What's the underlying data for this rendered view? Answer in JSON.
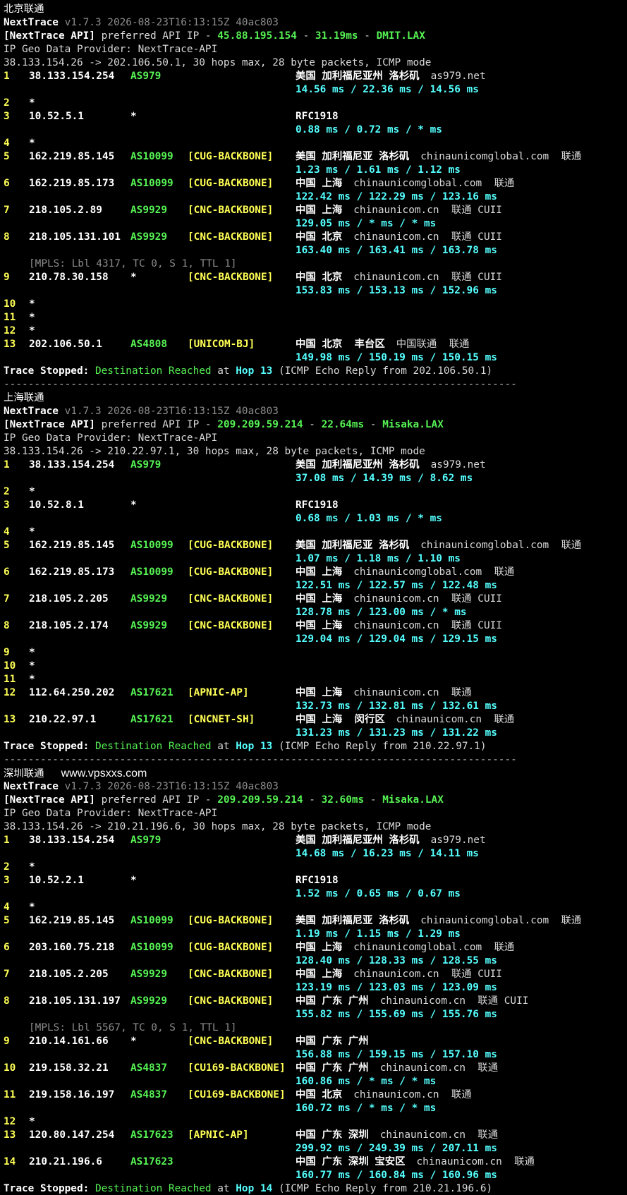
{
  "app": {
    "name": "NextTrace",
    "version": "v1.7.3 2026-08-23T16:13:15Z 40ac803"
  },
  "labels": {
    "api_prefix": "[NextTrace API]",
    "api_mid": "preferred API IP",
    "geo_line": "IP Geo Data Provider: NextTrace-API",
    "trace_stopped": "Trace Stopped:",
    "destination_reached": "Destination Reached",
    "at": "at",
    "hop_word": "Hop",
    "separator": "------------------------------------------------------------------------------------"
  },
  "watermark": "www.vpsxxs.com",
  "traces": [
    {
      "title": "北京联通",
      "api_ip": "45.88.195.154",
      "api_latency": "31.19ms",
      "api_node": "DMIT.LAX",
      "target_line": "38.133.154.26 -> 202.106.50.1, 30 hops max, 28 byte packets, ICMP mode",
      "hops": [
        {
          "n": "1",
          "ip": "38.133.154.254",
          "as": "AS979",
          "tag": "",
          "geo": "美国 加利福尼亚州 洛杉矶",
          "geo_extra": "as979.net",
          "rtt": "14.56 ms / 22.36 ms / 14.56 ms"
        },
        {
          "n": "2",
          "star": true
        },
        {
          "n": "3",
          "ip": "10.52.5.1",
          "as": "*",
          "tag": "",
          "geo": "RFC1918",
          "geo_extra": "",
          "rtt": "0.88 ms / 0.72 ms / * ms"
        },
        {
          "n": "4",
          "star": true
        },
        {
          "n": "5",
          "ip": "162.219.85.145",
          "as": "AS10099",
          "tag": "[CUG-BACKBONE]",
          "geo": "美国 加利福尼亚 洛杉矶",
          "geo_extra": "chinaunicomglobal.com  联通",
          "rtt": "1.23 ms / 1.61 ms / 1.12 ms"
        },
        {
          "n": "6",
          "ip": "162.219.85.173",
          "as": "AS10099",
          "tag": "[CUG-BACKBONE]",
          "geo": "中国 上海",
          "geo_extra": "chinaunicomglobal.com  联通",
          "rtt": "122.42 ms / 122.29 ms / 123.16 ms"
        },
        {
          "n": "7",
          "ip": "218.105.2.89",
          "as": "AS9929",
          "tag": "[CNC-BACKBONE]",
          "geo": "中国 上海",
          "geo_extra": "chinaunicom.cn  联通 CUII",
          "rtt": "129.05 ms / * ms / * ms"
        },
        {
          "n": "8",
          "ip": "218.105.131.101",
          "as": "AS9929",
          "tag": "[CNC-BACKBONE]",
          "geo": "中国 北京",
          "geo_extra": "chinaunicom.cn  联通 CUII",
          "rtt": "163.40 ms / 163.41 ms / 163.78 ms",
          "mpls": "[MPLS: Lbl 4317, TC 0, S 1, TTL 1]"
        },
        {
          "n": "9",
          "ip": "210.78.30.158",
          "as": "*",
          "tag": "[CNC-BACKBONE]",
          "geo": "中国 北京",
          "geo_extra": "chinaunicom.cn  联通 CUII",
          "rtt": "153.83 ms / 153.13 ms / 152.96 ms"
        },
        {
          "n": "10",
          "star": true
        },
        {
          "n": "11",
          "star": true
        },
        {
          "n": "12",
          "star": true
        },
        {
          "n": "13",
          "ip": "202.106.50.1",
          "as": "AS4808",
          "tag": "[UNICOM-BJ]",
          "geo": "中国 北京  丰台区",
          "geo_extra": "中国联通  联通",
          "rtt": "149.98 ms / 150.19 ms / 150.15 ms"
        }
      ],
      "stop_hop": "13",
      "stop_tail": "(ICMP Echo Reply from 202.106.50.1)"
    },
    {
      "title": "上海联通",
      "api_ip": "209.209.59.214",
      "api_latency": "22.64ms",
      "api_node": "Misaka.LAX",
      "target_line": "38.133.154.26 -> 210.22.97.1, 30 hops max, 28 byte packets, ICMP mode",
      "hops": [
        {
          "n": "1",
          "ip": "38.133.154.254",
          "as": "AS979",
          "tag": "",
          "geo": "美国 加利福尼亚州 洛杉矶",
          "geo_extra": "as979.net",
          "rtt": "37.08 ms / 14.39 ms / 8.62 ms"
        },
        {
          "n": "2",
          "star": true
        },
        {
          "n": "3",
          "ip": "10.52.8.1",
          "as": "*",
          "tag": "",
          "geo": "RFC1918",
          "geo_extra": "",
          "rtt": "0.68 ms / 1.03 ms / * ms"
        },
        {
          "n": "4",
          "star": true
        },
        {
          "n": "5",
          "ip": "162.219.85.145",
          "as": "AS10099",
          "tag": "[CUG-BACKBONE]",
          "geo": "美国 加利福尼亚 洛杉矶",
          "geo_extra": "chinaunicomglobal.com  联通",
          "rtt": "1.07 ms / 1.18 ms / 1.10 ms"
        },
        {
          "n": "6",
          "ip": "162.219.85.173",
          "as": "AS10099",
          "tag": "[CUG-BACKBONE]",
          "geo": "中国 上海",
          "geo_extra": "chinaunicomglobal.com  联通",
          "rtt": "122.51 ms / 122.57 ms / 122.48 ms"
        },
        {
          "n": "7",
          "ip": "218.105.2.205",
          "as": "AS9929",
          "tag": "[CNC-BACKBONE]",
          "geo": "中国 上海",
          "geo_extra": "chinaunicom.cn  联通 CUII",
          "rtt": "128.78 ms / 123.00 ms / * ms"
        },
        {
          "n": "8",
          "ip": "218.105.2.174",
          "as": "AS9929",
          "tag": "[CNC-BACKBONE]",
          "geo": "中国 上海",
          "geo_extra": "chinaunicom.cn  联通 CUII",
          "rtt": "129.04 ms / 129.04 ms / 129.15 ms"
        },
        {
          "n": "9",
          "star": true
        },
        {
          "n": "10",
          "star": true
        },
        {
          "n": "11",
          "star": true
        },
        {
          "n": "12",
          "ip": "112.64.250.202",
          "as": "AS17621",
          "tag": "[APNIC-AP]",
          "geo": "中国 上海",
          "geo_extra": "chinaunicom.cn  联通",
          "rtt": "132.73 ms / 132.81 ms / 132.61 ms"
        },
        {
          "n": "13",
          "ip": "210.22.97.1",
          "as": "AS17621",
          "tag": "[CNCNET-SH]",
          "geo": "中国 上海  闵行区",
          "geo_extra": "chinaunicom.cn  联通",
          "rtt": "131.23 ms / 131.23 ms / 131.22 ms"
        }
      ],
      "stop_hop": "13",
      "stop_tail": "(ICMP Echo Reply from 210.22.97.1)"
    },
    {
      "title": "深圳联通",
      "api_ip": "209.209.59.214",
      "api_latency": "32.60ms",
      "api_node": "Misaka.LAX",
      "target_line": "38.133.154.26 -> 210.21.196.6, 30 hops max, 28 byte packets, ICMP mode",
      "hops": [
        {
          "n": "1",
          "ip": "38.133.154.254",
          "as": "AS979",
          "tag": "",
          "geo": "美国 加利福尼亚州 洛杉矶",
          "geo_extra": "as979.net",
          "rtt": "14.68 ms / 16.23 ms / 14.11 ms"
        },
        {
          "n": "2",
          "star": true
        },
        {
          "n": "3",
          "ip": "10.52.2.1",
          "as": "*",
          "tag": "",
          "geo": "RFC1918",
          "geo_extra": "",
          "rtt": "1.52 ms / 0.65 ms / 0.67 ms"
        },
        {
          "n": "4",
          "star": true
        },
        {
          "n": "5",
          "ip": "162.219.85.145",
          "as": "AS10099",
          "tag": "[CUG-BACKBONE]",
          "geo": "美国 加利福尼亚 洛杉矶",
          "geo_extra": "chinaunicomglobal.com  联通",
          "rtt": "1.19 ms / 1.15 ms / 1.29 ms"
        },
        {
          "n": "6",
          "ip": "203.160.75.218",
          "as": "AS10099",
          "tag": "[CUG-BACKBONE]",
          "geo": "中国 上海",
          "geo_extra": "chinaunicomglobal.com  联通",
          "rtt": "128.40 ms / 128.33 ms / 128.55 ms"
        },
        {
          "n": "7",
          "ip": "218.105.2.205",
          "as": "AS9929",
          "tag": "[CNC-BACKBONE]",
          "geo": "中国 上海",
          "geo_extra": "chinaunicom.cn  联通 CUII",
          "rtt": "123.19 ms / 123.03 ms / 123.09 ms"
        },
        {
          "n": "8",
          "ip": "218.105.131.197",
          "as": "AS9929",
          "tag": "[CNC-BACKBONE]",
          "geo": "中国 广东 广州",
          "geo_extra": "chinaunicom.cn  联通 CUII",
          "rtt": "155.82 ms / 155.69 ms / 155.76 ms",
          "mpls": "[MPLS: Lbl 5567, TC 0, S 1, TTL 1]"
        },
        {
          "n": "9",
          "ip": "210.14.161.66",
          "as": "*",
          "tag": "[CNC-BACKBONE]",
          "geo": "中国 广东 广州",
          "geo_extra": "",
          "rtt": "156.88 ms / 159.15 ms / 157.10 ms"
        },
        {
          "n": "10",
          "ip": "219.158.32.21",
          "as": "AS4837",
          "tag": "[CU169-BACKBONE]",
          "geo": "中国 广东 广州",
          "geo_extra": "chinaunicom.cn  联通",
          "rtt": "160.86 ms / * ms / * ms"
        },
        {
          "n": "11",
          "ip": "219.158.16.197",
          "as": "AS4837",
          "tag": "[CU169-BACKBONE]",
          "geo": "中国 北京",
          "geo_extra": "chinaunicom.cn  联通",
          "rtt": "160.72 ms / * ms / * ms"
        },
        {
          "n": "12",
          "star": true
        },
        {
          "n": "13",
          "ip": "120.80.147.254",
          "as": "AS17623",
          "tag": "[APNIC-AP]",
          "geo": "中国 广东 深圳",
          "geo_extra": "chinaunicom.cn  联通",
          "rtt": "299.92 ms / 249.39 ms / 207.11 ms"
        },
        {
          "n": "14",
          "ip": "210.21.196.6",
          "as": "AS17623",
          "tag": "",
          "geo": "中国 广东 深圳 宝安区",
          "geo_extra": "chinaunicom.cn  联通",
          "rtt": "160.77 ms / 160.84 ms / 160.96 ms"
        }
      ],
      "stop_hop": "14",
      "stop_tail": "(ICMP Echo Reply from 210.21.196.6)"
    }
  ],
  "colors": {
    "green": "#56f254",
    "yellow": "#ffff55",
    "cyan": "#55ffff",
    "grey": "#8c8c8c"
  }
}
